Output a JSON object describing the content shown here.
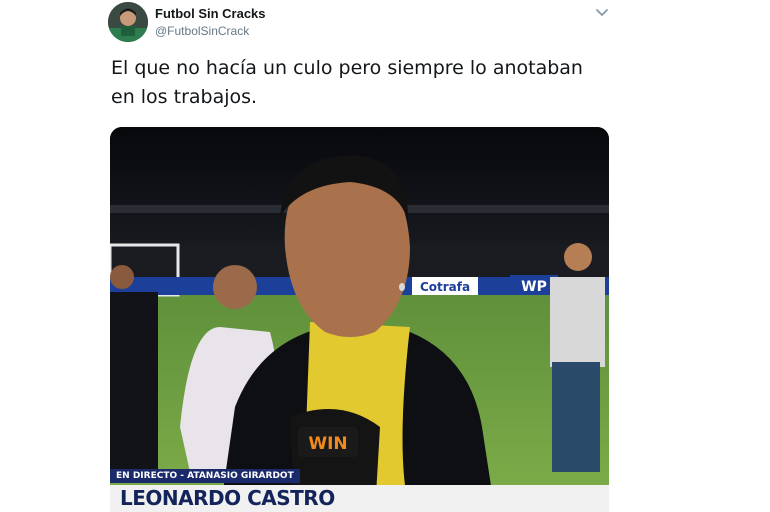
{
  "tweet": {
    "display_name": "Futbol Sin Cracks",
    "handle": "@FutbolSinCrack",
    "text": "El que no hacía un culo pero siempre lo anotaban en los trabajos.",
    "icons": {
      "menu": "chevron-down-icon"
    }
  },
  "media": {
    "broadcast_tag": "EN DIRECTO - ATANASIO GIRARDOT",
    "player_name": "LEONARDO CASTRO",
    "ad_board_1": "Cotrafa",
    "ad_board_2": "WP",
    "mic_logo": "WIN"
  },
  "colors": {
    "name_text": "#14171a",
    "handle_text": "#657786",
    "lower_third_bar": "#1b2a6b",
    "medal_ribbon": "#e2c92f"
  }
}
